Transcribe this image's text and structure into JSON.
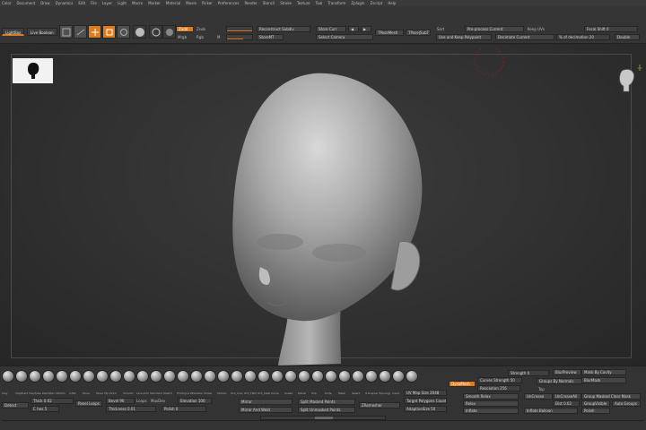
{
  "menu": [
    "Color",
    "Document",
    "Draw",
    "Dynamics",
    "Edit",
    "File",
    "Layer",
    "Light",
    "Macro",
    "Marker",
    "Material",
    "Movie",
    "Picker",
    "Preferences",
    "Render",
    "Stencil",
    "Stroke",
    "Texture",
    "Tool",
    "Transform",
    "Zplugin",
    "Zscript",
    "Help"
  ],
  "shelf": {
    "lightbox": "LightBox",
    "live_boolean": "Live Boolean",
    "edit": "Edit",
    "draw": "Draw",
    "move": "Move",
    "scale": "Scale",
    "rotate": "Rotate",
    "zadd": "Zadd",
    "zsub": "Zsub",
    "mrgb": "Mrgb",
    "rgb": "Rgb",
    "m": "M",
    "reconstruct_subdiv": "Reconstruct Subdiv",
    "store_curr": "Store Curr",
    "prev": "◀",
    "next": "▶",
    "tpose_mesh": "TPoseMesh",
    "tpose_subt": "TPose|SubT",
    "color_mt": "StoreMT",
    "select_camera": "Select Camera",
    "sort": "Sort",
    "pre_process_current": "Pre-process Current",
    "keep_uvs": "Keep UVs",
    "use_keep_polypaint": "Use and Keep Polypaint",
    "decimate_current": "Decimate Current",
    "pct_decimation": "% of decimation 20",
    "focal_shift": "Focal Shift 0",
    "double": "Double"
  },
  "tray": {
    "brush_labels": [
      "Clay",
      "ClayBuildup",
      "ClayTubes",
      "DamStandard",
      "hPolish",
      "Inflat",
      "Move",
      "Move Topo",
      "Pinch",
      "Smooth",
      "sCurveTube",
      "Standard",
      "Slash3",
      "TrimDynamic",
      "ZModeler",
      "Chisel",
      "hPolish",
      "Orb_Cracks",
      "Orb_Flatten",
      "Orb_Slash",
      "Curve",
      "Snake",
      "Planar",
      "Clip",
      "Knife",
      "Mask",
      "Select",
      "Transpose",
      "Topology",
      "Insert",
      "IMM"
    ],
    "detect": "Detect",
    "thick": "Thick 0.02",
    "c_hex": "C hex 5",
    "panel_loops": "Panel Loops",
    "bevel": "Bevel 96",
    "loops": "Loops",
    "maxdev": "MaxDev",
    "elevation": "Elevation 100",
    "thickness": "Thickness 0.01",
    "polish": "Polish 0",
    "mirror": "Mirror",
    "mirror_and_weld": "Mirror And Weld",
    "split_masked_points": "Split Masked Points",
    "split_unmasked_points": "Split Unmasked Points",
    "zremesher": "ZRemesher",
    "uv_map_size": "UV Map Size 2048",
    "target_polygons_count": "Target Polygons Count 5",
    "adaptive_size": "AdaptiveSize 50",
    "dynamesh": "DynaMesh",
    "curves_strength": "Curves Strength 50",
    "resolution": "Resolution 256",
    "groups_by_normals": "Groups By Normals",
    "mask_by_cavity": "Mask By Cavity",
    "blur_mask": "BlurMask",
    "strength": "Strength 0",
    "blur_preview": "BlurPreview",
    "top": "Top",
    "unmask": "UnCrease",
    "uncrease_all": "UnCreaseAll",
    "group_masked_clear_mask": "Group Masked Clear Mask",
    "smooth_relax": "Smooth Relax",
    "relax": "Relax",
    "inflate": "Inflate",
    "dist": "Dist 0.02",
    "group_visible": "GroupVisible",
    "auto_groups": "Auto Groups",
    "polish2": "Polish",
    "inflate_balloon": "Inflate Balloon"
  },
  "colors": {
    "accent": "#e07b1a",
    "panel": "#353535",
    "viewport": "#2f2f2f"
  }
}
